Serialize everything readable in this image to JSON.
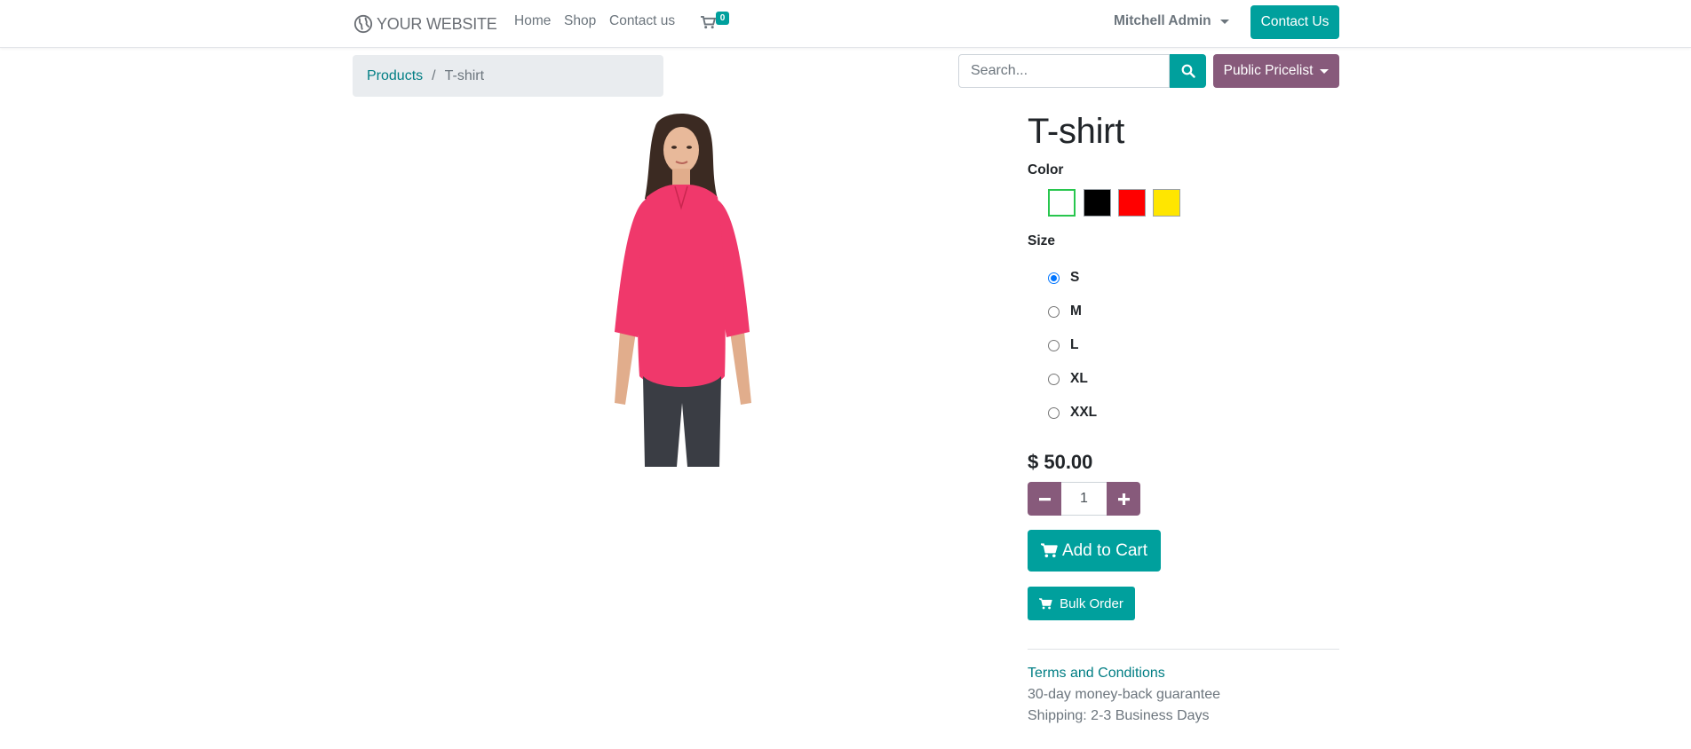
{
  "header": {
    "logo_text": "YOUR WEBSITE",
    "nav": [
      {
        "label": "Home"
      },
      {
        "label": "Shop"
      },
      {
        "label": "Contact us"
      }
    ],
    "cart_count": "0",
    "user_name": "Mitchell Admin",
    "contact_button": "Contact Us"
  },
  "breadcrumb": {
    "parent": "Products",
    "separator": "/",
    "current": "T-shirt"
  },
  "search": {
    "placeholder": "Search...",
    "value": ""
  },
  "pricelist": {
    "label": "Public Pricelist"
  },
  "product": {
    "image_description_icon": "product-photo-red-top",
    "title": "T-shirt",
    "color_label": "Color",
    "colors": [
      {
        "name": "white",
        "hex": "#ffffff",
        "selected": true
      },
      {
        "name": "black",
        "hex": "#000000",
        "selected": false
      },
      {
        "name": "red",
        "hex": "#ff0000",
        "selected": false
      },
      {
        "name": "yellow",
        "hex": "#ffe600",
        "selected": false
      }
    ],
    "size_label": "Size",
    "sizes": [
      {
        "label": "S",
        "selected": true
      },
      {
        "label": "M",
        "selected": false
      },
      {
        "label": "L",
        "selected": false
      },
      {
        "label": "XL",
        "selected": false
      },
      {
        "label": "XXL",
        "selected": false
      }
    ],
    "price": "$ 50.00",
    "quantity": "1",
    "add_to_cart": "Add to Cart",
    "bulk_order": "Bulk Order",
    "terms_link": "Terms and Conditions",
    "guarantee": "30-day money-back guarantee",
    "shipping": "Shipping: 2-3 Business Days"
  },
  "colors": {
    "primary": "#00a09d",
    "secondary": "#875a7b",
    "link": "#017e84"
  }
}
